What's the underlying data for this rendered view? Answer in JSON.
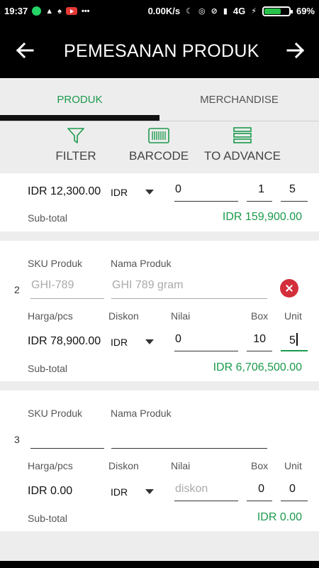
{
  "status_bar": {
    "time": "19:37",
    "speed": "0.00K/s",
    "network": "4G",
    "battery_percent": "69%",
    "battery_level": 0.69,
    "colors": {
      "battery": "#26c24a",
      "whatsapp": "#25d366",
      "youtube": "#e53935"
    }
  },
  "header": {
    "title": "PEMESANAN PRODUK",
    "back_icon": "arrow-left-icon",
    "forward_icon": "arrow-right-icon"
  },
  "tabs": [
    {
      "label": "PRODUK",
      "active": true
    },
    {
      "label": "MERCHANDISE",
      "active": false
    }
  ],
  "toolbar": {
    "filter_label": "FILTER",
    "barcode_label": "BARCODE",
    "advance_label": "TO ADVANCE"
  },
  "items": [
    {
      "price": "IDR 12,300.00",
      "discount_type": "IDR",
      "discount_value": "0",
      "box": "1",
      "unit": "5",
      "subtotal_label": "Sub-total",
      "subtotal": "IDR 159,900.00"
    },
    {
      "number": "2",
      "sku_label": "SKU Produk",
      "name_label": "Nama Produk",
      "sku_value": "GHI-789",
      "name_value": "GHI 789 gram",
      "price_label": "Harga/pcs",
      "discount_label": "Diskon",
      "value_label": "Nilai",
      "box_label": "Box",
      "unit_label": "Unit",
      "price": "IDR 78,900.00",
      "discount_type": "IDR",
      "discount_value": "0",
      "box": "10",
      "unit": "5",
      "subtotal_label": "Sub-total",
      "subtotal": "IDR 6,706,500.00"
    },
    {
      "number": "3",
      "sku_label": "SKU Produk",
      "name_label": "Nama Produk",
      "sku_value": "",
      "name_value": "",
      "price_label": "Harga/pcs",
      "discount_label": "Diskon",
      "value_label": "Nilai",
      "box_label": "Box",
      "unit_label": "Unit",
      "price": "IDR 0.00",
      "discount_type": "IDR",
      "discount_placeholder": "diskon",
      "box": "0",
      "unit": "0",
      "subtotal_label": "Sub-total",
      "subtotal": "IDR 0.00"
    }
  ],
  "colors": {
    "accent": "#1b9a4b",
    "remove": "#d32f3b",
    "header": "#000000"
  }
}
